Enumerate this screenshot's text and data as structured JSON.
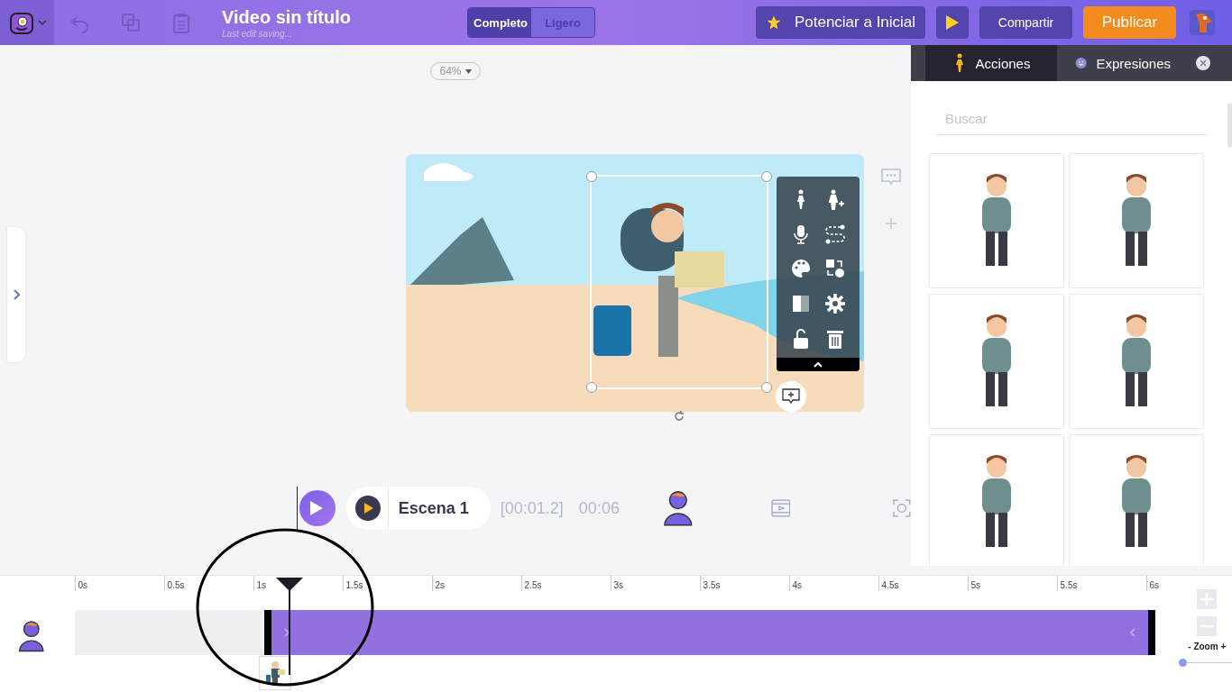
{
  "header": {
    "tools": [
      {
        "kind": "undo",
        "disabled": true
      },
      {
        "kind": "duplicate",
        "disabled": true
      },
      {
        "kind": "paste",
        "disabled": true
      }
    ],
    "title": "Video sin título",
    "subtitle": "Last edit saving...",
    "modes": [
      {
        "label": "Completo",
        "selected": true
      },
      {
        "label": "Ligero",
        "selected": false
      }
    ],
    "upgrade": "Potenciar a Inicial",
    "share": "Compartir",
    "publish": "Publicar"
  },
  "stage": {
    "zoom": "64%"
  },
  "panel": {
    "tabs": [
      {
        "label": "Acciones",
        "selected": true
      },
      {
        "label": "Expresiones",
        "selected": false
      }
    ],
    "search": {
      "placeholder": "Buscar"
    }
  },
  "playbar": {
    "scene": "Escena 1",
    "current_time": "[00:01.2]",
    "duration": "00:06"
  },
  "timeline": {
    "ticks": [
      "0s",
      "0.5s",
      "1s",
      "1.5s",
      "2s",
      "2.5s",
      "3s",
      "3.5s",
      "4s",
      "4.5s",
      "5s",
      "5.5s",
      "6s"
    ],
    "zoom_label": "- Zoom +",
    "zoom_level": {
      "level": 0
    }
  }
}
